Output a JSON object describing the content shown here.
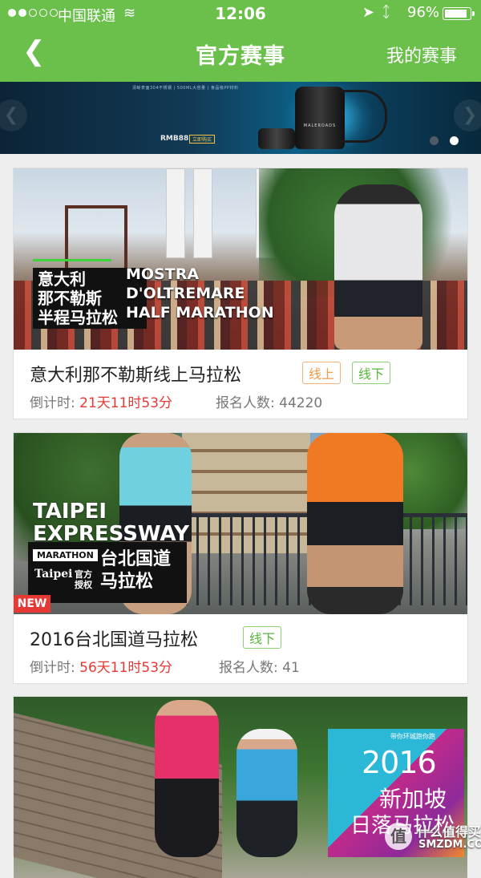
{
  "status_bar": {
    "carrier": "中国联通",
    "time": "12:06",
    "battery": "96%"
  },
  "nav": {
    "title": "官方赛事",
    "right_link": "我的赛事"
  },
  "banner": {
    "fine_print": "清晰表面304不锈钢 | 500ML大容量 | 食品级PP材料",
    "price": "RMB88",
    "buy_label": "立即购买",
    "bottle_brand": "MALEROADS",
    "page_count": 2,
    "active_page": 2
  },
  "events": [
    {
      "photo_text_cn": "意大利\n那不勒斯\n半程马拉松",
      "photo_text_en": "MOSTRA\nD'OLTREMARE\nHALF MARATHON",
      "title": "意大利那不勒斯线上马拉松",
      "tags": [
        "线上",
        "线下"
      ],
      "countdown_label": "倒计时:",
      "countdown": "21天11时53分",
      "signup_label": "报名人数:",
      "signup_count": "44220"
    },
    {
      "photo_text_en": "TAIPEI\nEXPRESSWAY",
      "photo_marathon": "MARATHON",
      "photo_logo": "Taipei",
      "photo_auth": "官方授权",
      "photo_text_cn": "台北国道\n马拉松",
      "badge": "NEW",
      "title": "2016台北国道马拉松",
      "tags": [
        "线下"
      ],
      "countdown_label": "倒计时:",
      "countdown": "56天11时53分",
      "signup_label": "报名人数:",
      "signup_count": "41"
    },
    {
      "photo_small": "带你环城跑你跑",
      "photo_year": "2016",
      "photo_line1": "新加坡",
      "photo_line2": "日落马拉松"
    }
  ],
  "watermark": {
    "icon_char": "值",
    "cn": "什么值得买",
    "en": "SMZDM.COM"
  },
  "colors": {
    "brand_green": "#6bc04b",
    "countdown_red": "#e53935",
    "online_tag": "#f09a4a",
    "offline_tag": "#58b53d"
  }
}
